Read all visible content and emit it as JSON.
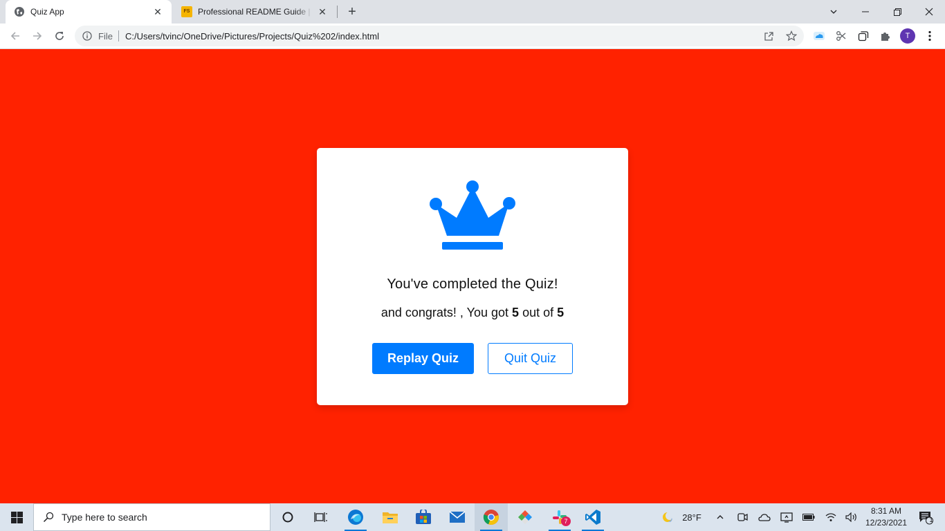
{
  "browser": {
    "tabs": [
      {
        "title": "Quiz App",
        "active": true
      },
      {
        "title": "Professional README Guide | The",
        "active": false,
        "favicon_text": "FS"
      }
    ],
    "address": {
      "scheme": "File",
      "url": "C:/Users/tvinc/OneDrive/Pictures/Projects/Quiz%202/index.html"
    },
    "profile_initial": "T"
  },
  "result": {
    "icon": "crown-icon",
    "title": "You've completed the Quiz!",
    "score_prefix": "and congrats! , You got",
    "score": "5",
    "score_middle": "out of",
    "total": "5",
    "replay_label": "Replay Quiz",
    "quit_label": "Quit Quiz"
  },
  "taskbar": {
    "search_placeholder": "Type here to search",
    "weather": "28°F",
    "time": "8:31 AM",
    "date": "12/23/2021",
    "slack_badge": "7",
    "notification_count": "1"
  },
  "colors": {
    "page_background": "#ff2200",
    "accent": "#007bff",
    "card": "#ffffff"
  }
}
